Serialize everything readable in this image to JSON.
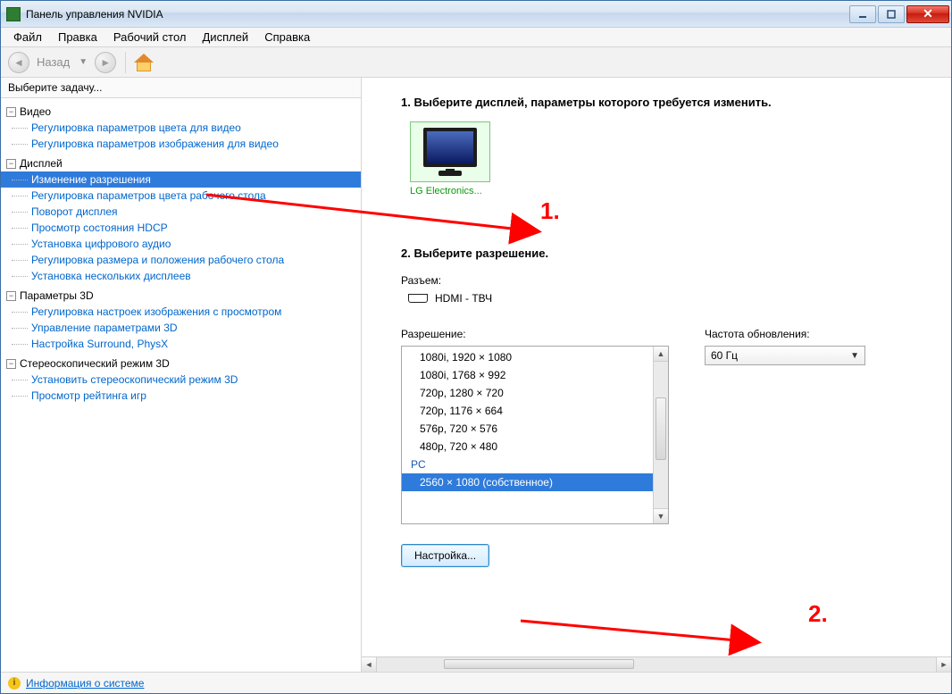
{
  "window": {
    "title": "Панель управления NVIDIA"
  },
  "menu": [
    "Файл",
    "Правка",
    "Рабочий стол",
    "Дисплей",
    "Справка"
  ],
  "nav": {
    "back": "Назад"
  },
  "sidebar": {
    "header": "Выберите задачу...",
    "groups": [
      {
        "label": "Видео",
        "items": [
          "Регулировка параметров цвета для видео",
          "Регулировка параметров изображения для видео"
        ]
      },
      {
        "label": "Дисплей",
        "items": [
          "Изменение разрешения",
          "Регулировка параметров цвета рабочего стола",
          "Поворот дисплея",
          "Просмотр состояния HDCP",
          "Установка цифрового аудио",
          "Регулировка размера и положения рабочего стола",
          "Установка нескольких дисплеев"
        ]
      },
      {
        "label": "Параметры 3D",
        "items": [
          "Регулировка настроек изображения с просмотром",
          "Управление параметрами 3D",
          "Настройка Surround, PhysX"
        ]
      },
      {
        "label": "Стереоскопический режим 3D",
        "items": [
          "Установить стереоскопический режим 3D",
          "Просмотр рейтинга игр"
        ]
      }
    ]
  },
  "content": {
    "step1_title": "1. Выберите дисплей, параметры которого требуется изменить.",
    "monitor_label": "LG Electronics...",
    "anno1": "1.",
    "step2_title": "2. Выберите разрешение.",
    "connector_label": "Разъем:",
    "connector_value": "HDMI - ТВЧ",
    "resolution_label": "Разрешение:",
    "refresh_label": "Частота обновления:",
    "refresh_value": "60 Гц",
    "config_btn": "Настройка...",
    "anno2": "2.",
    "res_group_pc": "PC",
    "resolutions": [
      "1080i, 1920 × 1080",
      "1080i, 1768 × 992",
      "720p, 1280 × 720",
      "720p, 1176 × 664",
      "576p, 720 × 576",
      "480p, 720 × 480"
    ],
    "res_selected": "2560 × 1080 (собственное)"
  },
  "footer": {
    "sysinfo": "Информация о системе"
  }
}
